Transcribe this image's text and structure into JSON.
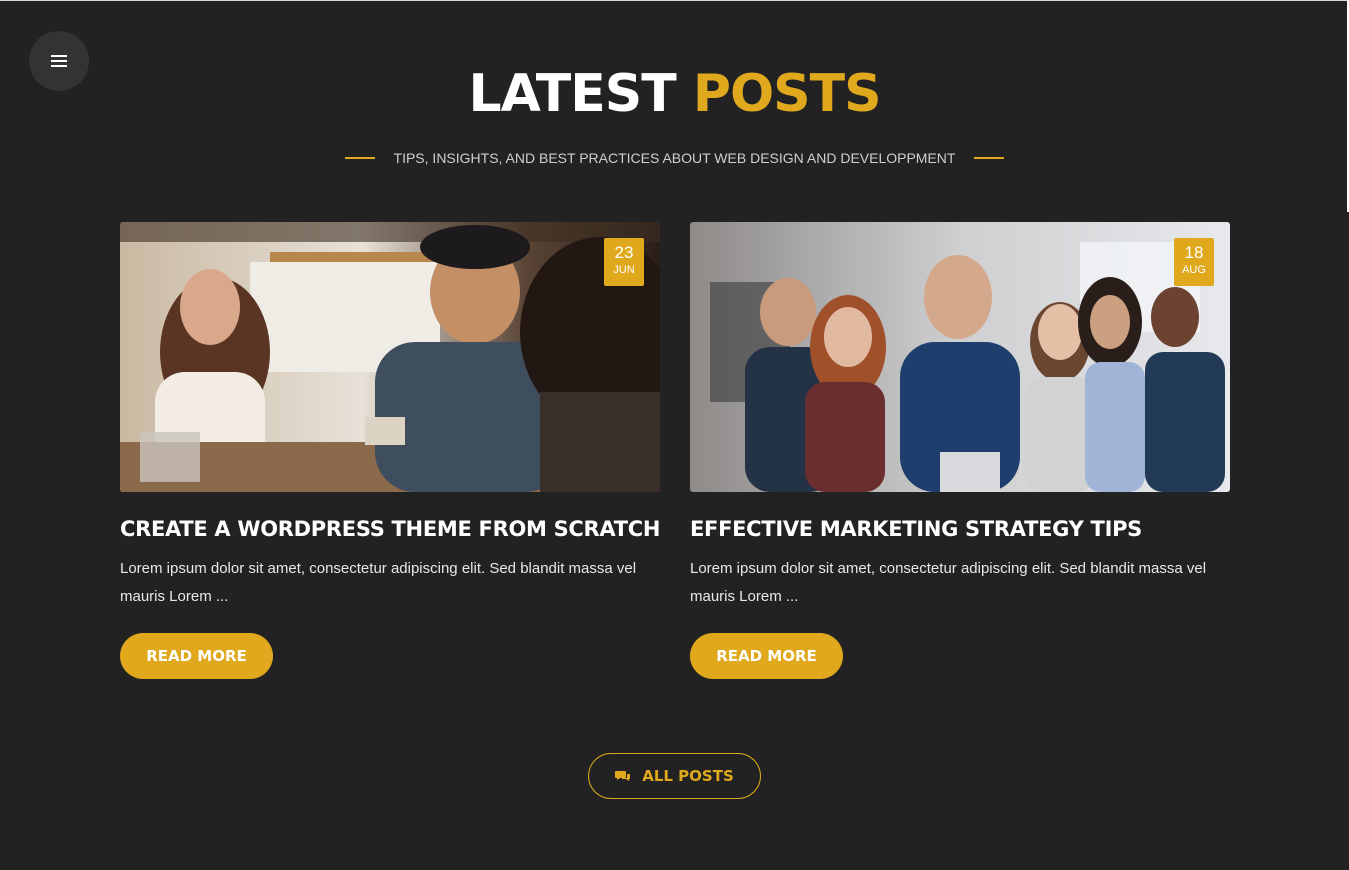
{
  "header": {
    "title_white": "LATEST",
    "title_accent": "POSTS",
    "subtitle": "TIPS, INSIGHTS, AND BEST PRACTICES ABOUT WEB DESIGN AND DEVELOPPMENT"
  },
  "menu": {
    "icon": "hamburger-menu-icon"
  },
  "posts": [
    {
      "day": "23",
      "month": "JUN",
      "title": "CREATE A WORDPRESS THEME FROM SCRATCH",
      "excerpt": "Lorem ipsum dolor sit amet, consectetur adipiscing elit. Sed blandit massa vel mauris Lorem ...",
      "button": "READ MORE"
    },
    {
      "day": "18",
      "month": "AUG",
      "title": "EFFECTIVE MARKETING STRATEGY TIPS",
      "excerpt": "Lorem ipsum dolor sit amet, consectetur adipiscing elit. Sed blandit massa vel mauris Lorem ...",
      "button": "READ MORE"
    }
  ],
  "all_posts": {
    "label": "ALL POSTS",
    "icon": "comments-icon"
  },
  "colors": {
    "accent": "#e0a81d",
    "background": "#222222"
  }
}
